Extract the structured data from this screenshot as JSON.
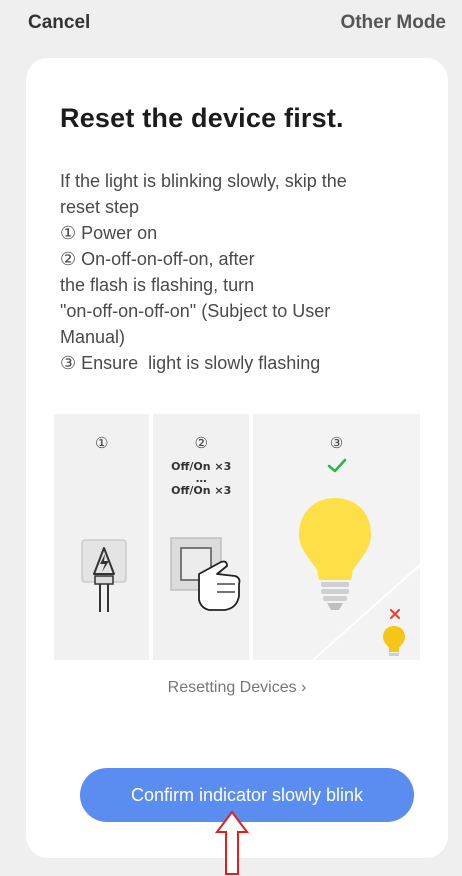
{
  "topbar": {
    "cancel_label": "Cancel",
    "other_mode_label": "Other Mode"
  },
  "card": {
    "title": "Reset the device first.",
    "instructions": [
      "If the light is blinking slowly, skip the",
      "reset step",
      "① Power on",
      "② On-off-on-off-on, after",
      "the flash is flashing, turn",
      "\"on-off-on-off-on\" (Subject to User",
      "Manual)",
      "③ Ensure  light is slowly flashing"
    ],
    "steps": {
      "step1_num": "①",
      "step2_num": "②",
      "step3_num": "③",
      "step2_line1": "Off/On ×3",
      "step2_dots": "…",
      "step2_line2": "Off/On ×3"
    },
    "resetting_link": "Resetting Devices  ›",
    "confirm_button": "Confirm indicator slowly blink"
  },
  "colors": {
    "accent": "#5b8df0",
    "check": "#2bb44a",
    "cross": "#e8443a",
    "bulb": "#fde047",
    "arrow": "#e02020"
  },
  "icons": [
    "power-plug-icon",
    "light-switch-icon",
    "hand-pointer-icon",
    "light-bulb-bright-icon",
    "light-bulb-small-icon",
    "check-icon",
    "cross-icon",
    "up-arrow-annotation"
  ]
}
